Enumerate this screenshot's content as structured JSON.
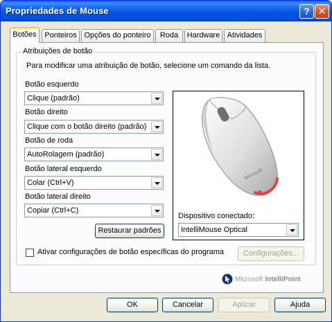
{
  "window": {
    "title": "Propriedades de Mouse",
    "help_label": "?",
    "close_label": "✕"
  },
  "tabs": [
    {
      "label": "Botões"
    },
    {
      "label": "Ponteiros"
    },
    {
      "label": "Opções do ponteiro"
    },
    {
      "label": "Roda"
    },
    {
      "label": "Hardware"
    },
    {
      "label": "Atividades"
    }
  ],
  "group": {
    "title": "Atribuições de botão",
    "instruction": "Para modificar uma atribuição de botão, selecione um comando da lista."
  },
  "buttons": [
    {
      "label": "Botão esquerdo",
      "value": "Clique (padrão)"
    },
    {
      "label": "Botão direito",
      "value": "Clique com o botão direito (padrão)"
    },
    {
      "label": "Botão de roda",
      "value": "AutoRolagem (padrão)"
    },
    {
      "label": "Botão lateral esquerdo",
      "value": "Colar (Ctrl+V)"
    },
    {
      "label": "Botão lateral direito",
      "value": "Copiar (Ctrl+C)"
    }
  ],
  "restore_label": "Restaurar padrões",
  "device": {
    "label": "Dispositivo conectado:",
    "value": "IntelliMouse Optical"
  },
  "mouse_brand": "Microsoft",
  "program_checkbox": {
    "label": "Ativar configurações de botão específicas do programa",
    "checked": false
  },
  "config_label": "Configurações...",
  "branding": {
    "prefix": "Microsoft",
    "product": "IntelliPoint"
  },
  "dialog": {
    "ok": "OK",
    "cancel": "Cancelar",
    "apply": "Aplicar",
    "help": "Ajuda"
  },
  "colors": {
    "titlebar": "#0054e3",
    "dialog_bg": "#ece9d8",
    "tab_highlight": "#ffc83c"
  }
}
